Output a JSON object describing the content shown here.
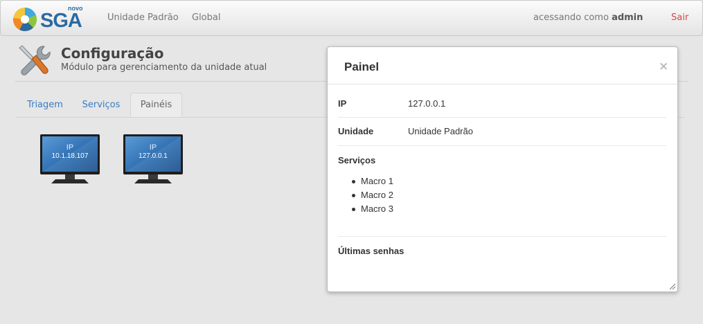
{
  "brand": {
    "prefix": "novo",
    "name": "SGA"
  },
  "nav": {
    "items": [
      {
        "label": "Unidade Padrão"
      },
      {
        "label": "Global"
      }
    ],
    "user_prefix": "acessando como",
    "user_name": "admin",
    "logout_label": "Sair"
  },
  "header": {
    "title": "Configuração",
    "subtitle": "Módulo para gerenciamento da unidade atual"
  },
  "tabs": [
    {
      "label": "Triagem",
      "active": false
    },
    {
      "label": "Serviços",
      "active": false
    },
    {
      "label": "Painéis",
      "active": true
    }
  ],
  "panels": [
    {
      "ip_label": "IP",
      "ip": "10.1.18.107"
    },
    {
      "ip_label": "IP",
      "ip": "127.0.0.1"
    }
  ],
  "modal": {
    "title": "Painel",
    "close_symbol": "×",
    "ip_label": "IP",
    "ip_value": "127.0.0.1",
    "unit_label": "Unidade",
    "unit_value": "Unidade Padrão",
    "services_label": "Serviços",
    "services": [
      "Macro 1",
      "Macro 2",
      "Macro 3"
    ],
    "recent_label": "Últimas senhas"
  },
  "colors": {
    "brand": "#2c6aa0",
    "link": "#3a7cc1",
    "logout": "#dd4444"
  },
  "icons": [
    "brand-swirl-icon",
    "tools-icon",
    "monitor-icon",
    "close-icon",
    "resize-grip-icon"
  ]
}
